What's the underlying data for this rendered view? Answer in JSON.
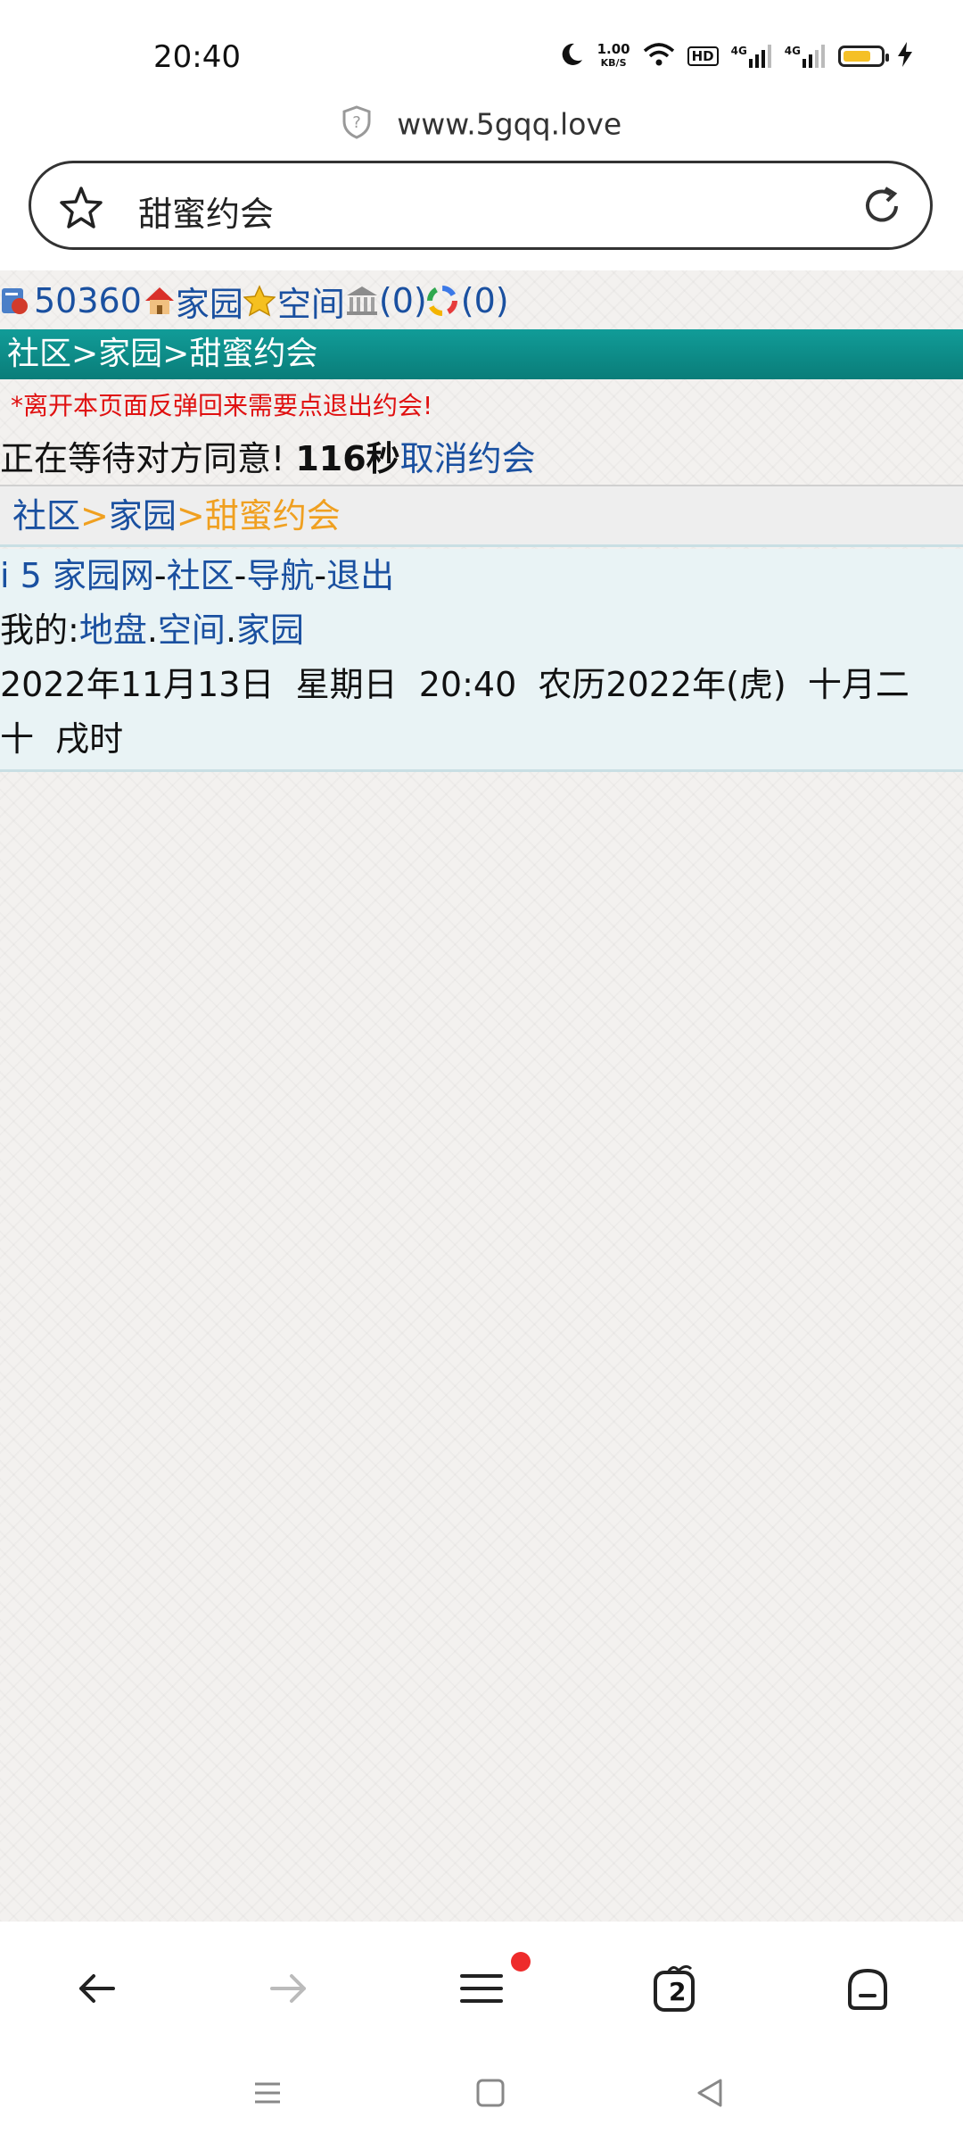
{
  "status_bar": {
    "time": "20:40",
    "net_speed_value": "1.00",
    "net_speed_unit": "KB/S",
    "hd_label": "HD",
    "signal1_label": "4G",
    "signal2_label": "4G",
    "battery_level": 0.75,
    "battery_color": "#f5c026"
  },
  "browser": {
    "url": "www.5gqq.love",
    "page_title": "甜蜜约会"
  },
  "page": {
    "top_links": {
      "count": "50360",
      "home": "家园",
      "space": "空间",
      "bank_count": "(0)",
      "color_count": "(0)"
    },
    "nav_title": "社区>家园>甜蜜约会",
    "warning": "*离开本页面反弹回来需要点退出约会!",
    "waiting_text": "正在等待对方同意!",
    "countdown": "116秒",
    "cancel_link": "取消约会",
    "breadcrumb": {
      "community": "社区",
      "sep1": ">",
      "home": "家园",
      "sep2": ">",
      "current": "甜蜜约会"
    },
    "footer": {
      "site_name": "i 5 家园网",
      "dash1": "-",
      "community": "社区",
      "dash2": "-",
      "navigation": "导航",
      "dash3": "-",
      "logout": "退出",
      "my_label": "我的:",
      "my_land": "地盘",
      "dot1": ".",
      "my_space": "空间",
      "dot2": ".",
      "my_home": "家园",
      "date_line1": "2022年11月13日  星期日  20:40  农历2022年(虎)  十月二",
      "date_line2": "十  戌时"
    },
    "colors": {
      "link": "#1a50a0",
      "nav_bar": "#0a7d79",
      "warning": "#e01010",
      "breadcrumb_current": "#f0a020"
    }
  },
  "bottom_bar": {
    "tabs_count": "2",
    "icons": [
      "back-arrow-icon",
      "forward-arrow-icon",
      "menu-icon",
      "tabs-icon",
      "home-icon"
    ]
  },
  "system_nav": {
    "icons": [
      "recents-icon",
      "home-square-icon",
      "back-triangle-icon"
    ]
  }
}
